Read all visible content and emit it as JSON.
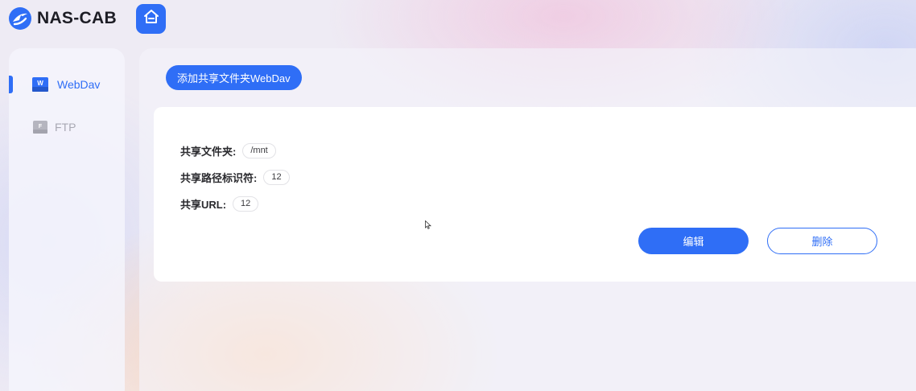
{
  "header": {
    "app_name": "NAS-CAB",
    "logo_icon": "nas-cab-logo-icon",
    "home_icon": "home-icon",
    "accent_color": "#2f6ef6"
  },
  "sidebar": {
    "items": [
      {
        "label": "WebDav",
        "icon": "webdav-icon",
        "active": true
      },
      {
        "label": "FTP",
        "icon": "ftp-icon",
        "active": false
      }
    ]
  },
  "main": {
    "add_button_label": "添加共享文件夹WebDav",
    "share": {
      "folder_label": "共享文件夹:",
      "folder_value": "/mnt",
      "path_id_label": "共享路径标识符:",
      "path_id_value": "12",
      "url_label": "共享URL:",
      "url_value": "12"
    },
    "edit_label": "编辑",
    "delete_label": "删除"
  }
}
